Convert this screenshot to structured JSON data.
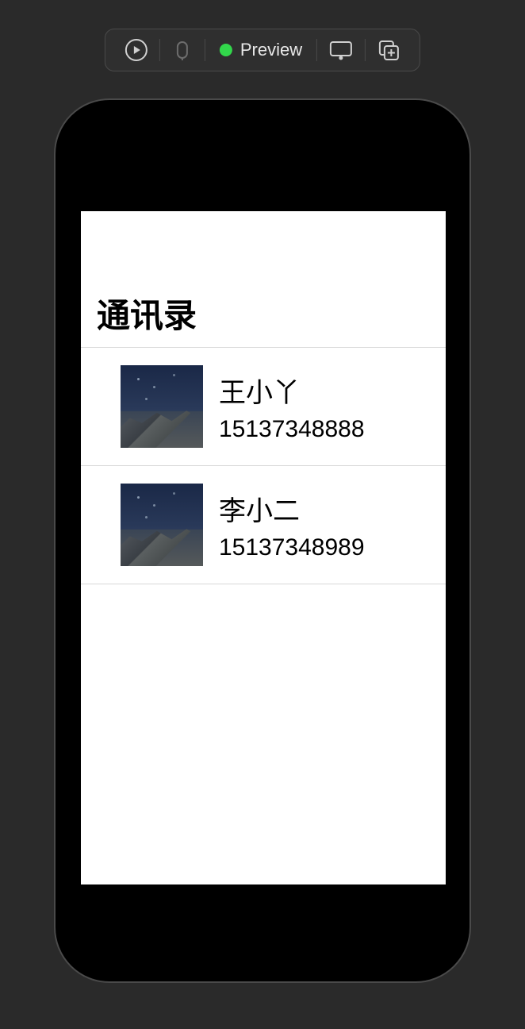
{
  "toolbar": {
    "preview_label": "Preview",
    "icons": {
      "play": "play-icon",
      "stop": "stop-icon",
      "device": "device-icon",
      "add_window": "add-window-icon"
    }
  },
  "app": {
    "page_title": "通讯录",
    "contacts": [
      {
        "name": "王小丫",
        "phone": "15137348888"
      },
      {
        "name": "李小二",
        "phone": "15137348989"
      }
    ]
  }
}
